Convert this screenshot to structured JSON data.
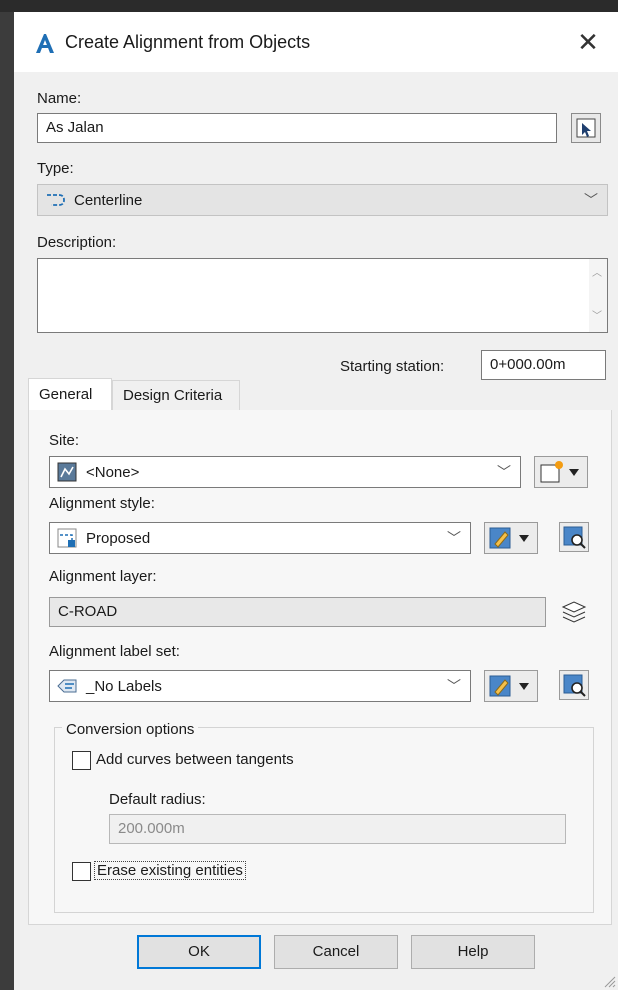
{
  "dialog": {
    "title": "Create Alignment from Objects",
    "close_glyph": "✕"
  },
  "fields": {
    "name_label": "Name:",
    "name_value": "As Jalan",
    "type_label": "Type:",
    "type_value": "Centerline",
    "description_label": "Description:",
    "description_value": "",
    "starting_station_label": "Starting station:",
    "starting_station_value": "0+000.00m"
  },
  "tabs": [
    {
      "label": "General",
      "active": true
    },
    {
      "label": "Design Criteria",
      "active": false
    }
  ],
  "general": {
    "site_label": "Site:",
    "site_value": "<None>",
    "alignment_style_label": "Alignment style:",
    "alignment_style_value": "Proposed",
    "alignment_layer_label": "Alignment layer:",
    "alignment_layer_value": "C-ROAD",
    "label_set_label": "Alignment label set:",
    "label_set_value": "_No Labels"
  },
  "conversion": {
    "group_title": "Conversion options",
    "add_curves_label": "Add curves between tangents",
    "add_curves_checked": false,
    "default_radius_label": "Default radius:",
    "default_radius_value": "200.000m",
    "erase_label": "Erase existing entities",
    "erase_checked": false
  },
  "buttons": {
    "ok": "OK",
    "cancel": "Cancel",
    "help": "Help"
  },
  "colors": {
    "accent": "#0078d7",
    "dialog_bg": "#f0f0f0",
    "panel_bg": "#f7f7f7"
  }
}
